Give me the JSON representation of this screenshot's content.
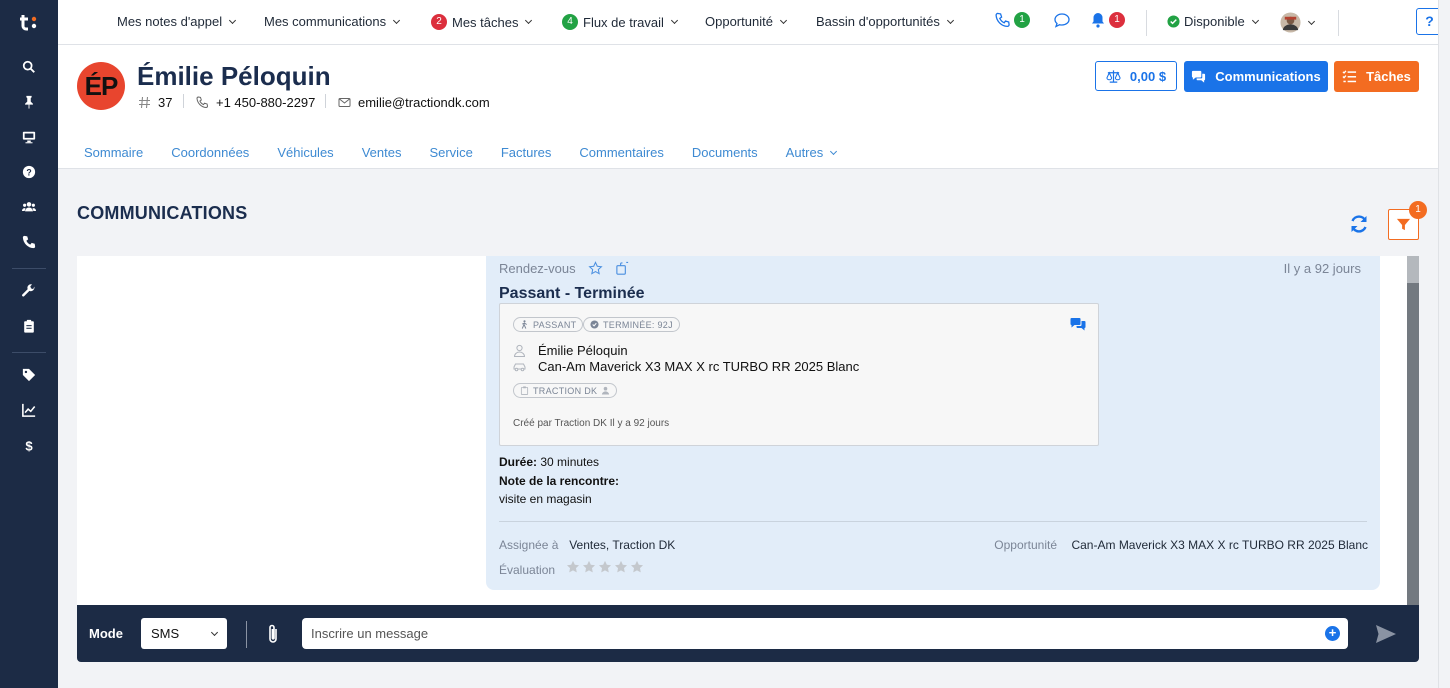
{
  "topnav": {
    "call_notes": "Mes notes d'appel",
    "communications": "Mes communications",
    "tasks": "Mes tâches",
    "tasks_count": "2",
    "workflow": "Flux de travail",
    "workflow_count": "4",
    "opportunity": "Opportunité",
    "opportunity_pool": "Bassin d'opportunités",
    "phone_count": "1",
    "notif_count": "1",
    "status": "Disponible",
    "help": "?"
  },
  "contact": {
    "initials": "ÉP",
    "name": "Émilie Péloquin",
    "id": "37",
    "phone": "+1 450-880-2297",
    "email": "emilie@tractiondk.com",
    "balance": "0,00 $",
    "communications_btn": "Communications",
    "tasks_btn": "Tâches"
  },
  "tabs": [
    "Sommaire",
    "Coordonnées",
    "Véhicules",
    "Ventes",
    "Service",
    "Factures",
    "Commentaires",
    "Documents",
    "Autres"
  ],
  "section": {
    "title": "COMMUNICATIONS",
    "filter_count": "1"
  },
  "card": {
    "type": "Rendez-vous",
    "time": "Il y a 92 jours",
    "title": "Passant - Terminée",
    "pill_walkin": "PASSANT",
    "pill_done": "TERMINÉE: 92J",
    "person": "Émilie Péloquin",
    "vehicle": "Can-Am Maverick X3 MAX X rc TURBO RR 2025 Blanc",
    "pill_dealer": "TRACTION DK",
    "created": "Créé par Traction DK Il y a 92 jours",
    "duration_label": "Durée:",
    "duration_value": "30 minutes",
    "note_label": "Note de la rencontre:",
    "note_value": "visite en magasin",
    "assigned_label": "Assignée à",
    "assigned_value": "Ventes, Traction DK",
    "opportunity_label": "Opportunité",
    "opportunity_value": "Can-Am Maverick X3 MAX X rc TURBO RR 2025 Blanc",
    "rating_label": "Évaluation",
    "rating": 0
  },
  "composer": {
    "mode_label": "Mode",
    "mode_value": "SMS",
    "placeholder": "Inscrire un message"
  },
  "colors": {
    "sidebar": "#1c2b45",
    "accent_blue": "#1a73e8",
    "accent_orange": "#f36c21",
    "card_bg": "#e2edf9"
  }
}
